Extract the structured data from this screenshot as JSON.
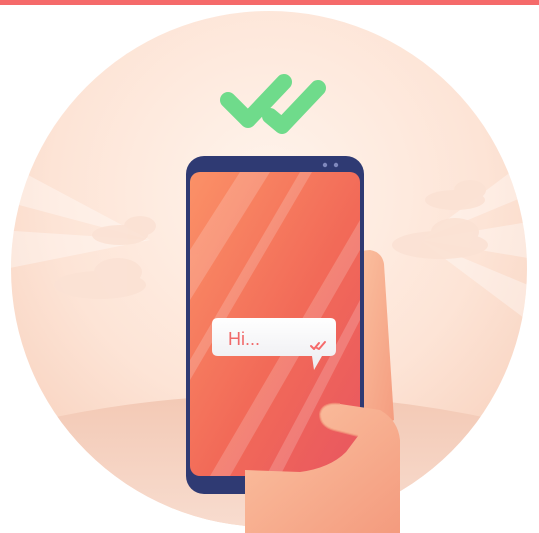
{
  "message": {
    "text": "Hi...",
    "status": "delivered-read"
  },
  "icons": {
    "top": "double-check-icon",
    "bubble": "double-check-icon"
  },
  "colors": {
    "top_bar": "#f56a6a",
    "check_green": "#6fdb8b",
    "phone_screen": "#f36f5a",
    "phone_frame": "#2f3a73",
    "bubble_check": "#f56a6a",
    "hand": "#f8b08f"
  }
}
